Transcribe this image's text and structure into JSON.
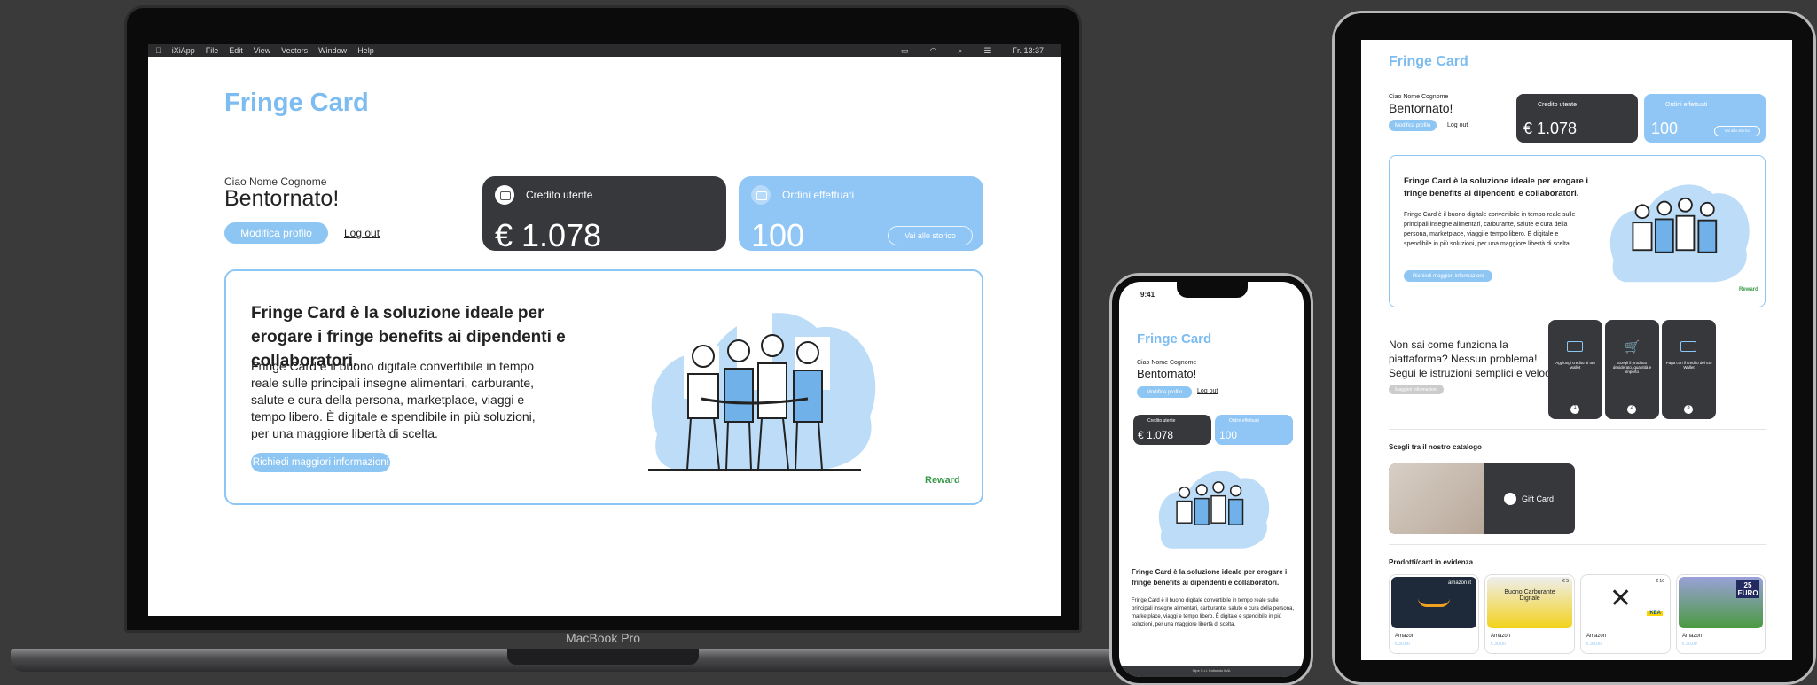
{
  "mac": {
    "menu": [
      "iXiApp",
      "File",
      "Edit",
      "View",
      "Vectors",
      "Window",
      "Help"
    ],
    "clock": "Fr. 13:37",
    "device_label": "MacBook Pro"
  },
  "app": {
    "brand": "Fringe Card",
    "greeting": "Ciao Nome Cognome",
    "welcome": "Bentornato!",
    "edit_profile": "Modifica profilo",
    "logout": "Log out",
    "credit_title": "Credito utente",
    "credit_value": "€ 1.078",
    "orders_title": "Ordini effettuati",
    "orders_value": "100",
    "history_button": "Vai allo storico",
    "headline": "Fringe Card è la soluzione ideale per erogare i fringe benefits ai dipendenti e collaboratori.",
    "description": "Fringe Card è il buono digitale convertibile in tempo reale sulle principali insegne alimentari, carburante, salute e cura della persona, marketplace, viaggi e tempo libero. È digitale e spendibile in più soluzioni, per una maggiore libertà di scelta.",
    "more_info": "Richiedi maggiori informazioni",
    "reward_logo": "Reward"
  },
  "phone": {
    "time": "9:41",
    "footer_text": "Hipe S.r.l. Fatturato IIVA"
  },
  "tablet": {
    "howto": "Non sai come funziona la piattaforma? Nessun problema! Segui le istruzioni semplici e veloci.",
    "howto_button": "Maggiori informazioni",
    "steps": [
      {
        "text": "Aggiungi credito al tuo wallet",
        "num": "1"
      },
      {
        "text": "Scegli il prodotto desiderato, quantità e importo",
        "num": "2"
      },
      {
        "text": "Paga con il credito del tuo Wallet",
        "num": "3"
      }
    ],
    "catalog_title": "Scegli tra il nostro catalogo",
    "giftcard_label": "Gift Card",
    "featured_title": "Prodotti/card in evidenza",
    "products": [
      {
        "brand": "amazon.it",
        "name": "Amazon",
        "price": "€ 30,00",
        "tag": ""
      },
      {
        "brand": "Buono Carburante Digitale",
        "name": "Amazon",
        "price": "€ 30,00",
        "tag": "€ 5"
      },
      {
        "brand": "IKEA",
        "name": "Amazon",
        "price": "€ 30,00",
        "tag": "€ 10"
      },
      {
        "brand": "25 EURO",
        "name": "Amazon",
        "price": "€ 30,00",
        "tag": ""
      }
    ]
  },
  "colors": {
    "accent": "#8ec6f3",
    "dark_card": "#37383b",
    "brand": "#7cbcf0",
    "reward": "#3a9a4a"
  }
}
